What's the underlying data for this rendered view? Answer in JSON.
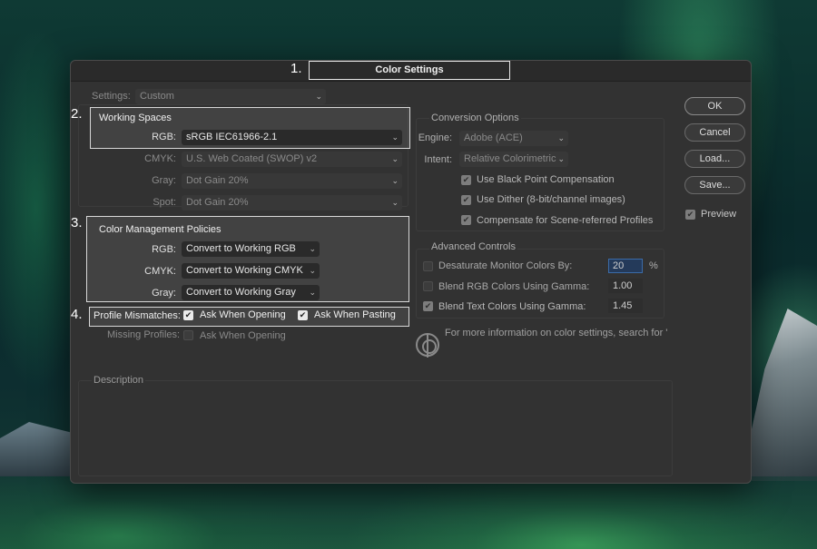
{
  "dialog": {
    "title": "Color Settings"
  },
  "steps": [
    "1.",
    "2.",
    "3.",
    "4."
  ],
  "settings": {
    "label": "Settings:",
    "value": "Custom"
  },
  "working_spaces": {
    "title": "Working Spaces",
    "rgb": {
      "label": "RGB:",
      "value": "sRGB IEC61966-2.1"
    },
    "cmyk": {
      "label": "CMYK:",
      "value": "U.S. Web Coated (SWOP) v2"
    },
    "gray": {
      "label": "Gray:",
      "value": "Dot Gain 20%"
    },
    "spot": {
      "label": "Spot:",
      "value": "Dot Gain 20%"
    }
  },
  "policies": {
    "title": "Color Management Policies",
    "rgb": {
      "label": "RGB:",
      "value": "Convert to Working RGB"
    },
    "cmyk": {
      "label": "CMYK:",
      "value": "Convert to Working CMYK"
    },
    "gray": {
      "label": "Gray:",
      "value": "Convert to Working Gray"
    }
  },
  "mismatches": {
    "label": "Profile Mismatches:",
    "opening": "Ask When Opening",
    "pasting": "Ask When Pasting"
  },
  "missing": {
    "label": "Missing Profiles:",
    "opening": "Ask When Opening"
  },
  "conversion": {
    "title": "Conversion Options",
    "engine": {
      "label": "Engine:",
      "value": "Adobe (ACE)"
    },
    "intent": {
      "label": "Intent:",
      "value": "Relative Colorimetric"
    },
    "black_point": "Use Black Point Compensation",
    "dither": "Use Dither (8-bit/channel images)",
    "scene": "Compensate for Scene-referred Profiles"
  },
  "advanced": {
    "title": "Advanced Controls",
    "desaturate": {
      "label": "Desaturate Monitor Colors By:",
      "value": "20",
      "unit": "%"
    },
    "blend_rgb": {
      "label": "Blend RGB Colors Using Gamma:",
      "value": "1.00"
    },
    "blend_text": {
      "label": "Blend Text Colors Using Gamma:",
      "value": "1.45"
    }
  },
  "info_text": "For more information on color settings, search for \"...",
  "description": {
    "title": "Description"
  },
  "buttons": {
    "ok": "OK",
    "cancel": "Cancel",
    "load": "Load...",
    "save": "Save..."
  },
  "preview": {
    "label": "Preview",
    "checked": true
  },
  "checkmark": "✔",
  "chevron": "⌄"
}
